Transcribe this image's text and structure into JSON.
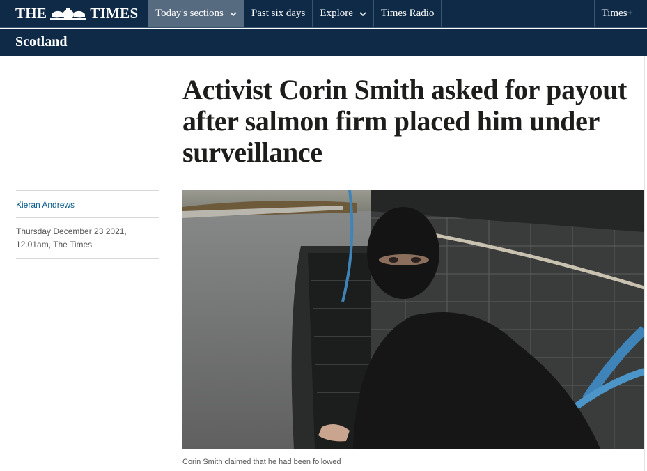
{
  "brand": {
    "logo_left": "THE",
    "logo_right": "TIMES"
  },
  "nav": {
    "items": [
      {
        "label": "Today's sections",
        "dropdown": true,
        "active": true
      },
      {
        "label": "Past six days",
        "dropdown": false,
        "active": false
      },
      {
        "label": "Explore",
        "dropdown": true,
        "active": false
      },
      {
        "label": "Times Radio",
        "dropdown": false,
        "active": false
      }
    ],
    "right_label": "Times+"
  },
  "section": {
    "title": "Scotland"
  },
  "article": {
    "headline": "Activist Corin Smith asked for payout after salmon firm placed him under surveillance",
    "author": "Kieran Andrews",
    "date_line1": "Thursday December 23 2021,",
    "date_line2": "12.01am, The Times",
    "caption": "Corin Smith claimed that he had been followed"
  },
  "colors": {
    "nav_bg": "#0e2a47",
    "nav_active": "#566a80",
    "author_link": "#005689"
  },
  "icons": [
    "chevron-down-icon",
    "crest-icon"
  ]
}
